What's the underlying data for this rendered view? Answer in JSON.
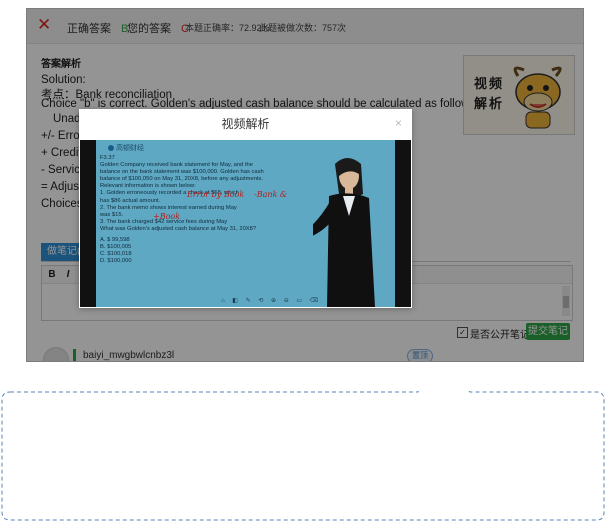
{
  "topbar": {
    "correct_label": "正确答案",
    "correct_value": "B",
    "your_label": "您的答案",
    "your_value": "C",
    "accuracy": "本题正确率：72.92%",
    "attempts": "此题被做次数：757次"
  },
  "analysis": {
    "section_title": "答案解析",
    "lines": [
      "Solution:",
      "考点：Bank reconciliation",
      "Choice \"b\" is correct. Golden's adjusted cash balance should be calculated as follows:",
      "Unadj",
      "+/-   Errors",
      "+     Credit",
      "-     Servic",
      "=     Adjust",
      "Choices \"a"
    ]
  },
  "mascot": {
    "text": "视频解析"
  },
  "notes": {
    "tab_label": "做笔记(",
    "toolbar": [
      "B",
      "I",
      "U"
    ],
    "public_label": "是否公开笔记",
    "submit_label": "提交笔记"
  },
  "comment": {
    "username": "baiyi_mwgbwlcnbz3l",
    "tag": "置顶"
  },
  "modal": {
    "title": "视频解析",
    "close": "×",
    "board_logo": "高顿财经",
    "question": [
      "F3.37",
      "Golden Company received bank statement for May, and the",
      "balance on the bank statement was $100,000. Golden has cash",
      "balance of $100,050 on May 31, 20X8, before any adjustments.",
      "Relevant information is shown below:",
      "1.   Golden erroneously recorded a check at $68, which",
      "      has $86 actual amount.",
      "2.   The bank memo shows interest earned during May",
      "      was $15.",
      "3.   The bank charged $42 service fees during May",
      "What was Golden's adjusted cash balance at May 31, 20X8?",
      "",
      "A.  $  99,598",
      "B.  $100,005",
      "C.  $100,018",
      "D.  $100,000"
    ],
    "handwriting": [
      "Error by Book",
      "-Bank &",
      "+Book"
    ],
    "board_tools": "⌂ ◧ ✎ ⟲ ⊕ ⊖ ▭ ⌫"
  },
  "colors": {
    "accent_blue": "#2d8fd5",
    "green": "#2fa546",
    "error_red": "#d9261c",
    "tooltip_border": "#5a86b8"
  }
}
